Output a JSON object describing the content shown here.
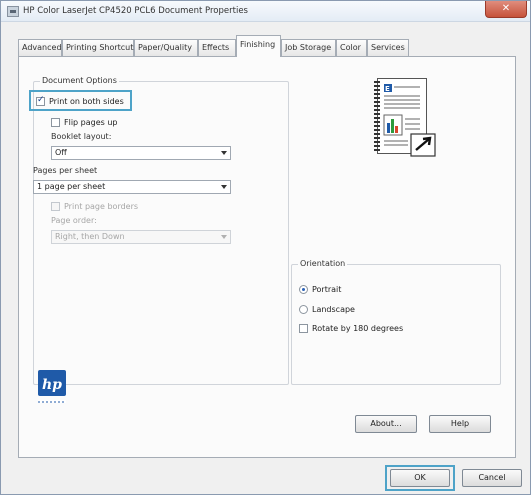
{
  "window": {
    "title": "HP Color LaserJet CP4520 PCL6 Document Properties",
    "close_label": "✕"
  },
  "tabs": [
    {
      "label": "Advanced",
      "active": false
    },
    {
      "label": "Printing Shortcuts",
      "active": false
    },
    {
      "label": "Paper/Quality",
      "active": false
    },
    {
      "label": "Effects",
      "active": false
    },
    {
      "label": "Finishing",
      "active": true
    },
    {
      "label": "Job Storage",
      "active": false
    },
    {
      "label": "Color",
      "active": false
    },
    {
      "label": "Services",
      "active": false
    }
  ],
  "document_options": {
    "group_label": "Document Options",
    "print_both_sides": {
      "label": "Print on both sides",
      "checked": true
    },
    "flip_pages_up": {
      "label": "Flip pages up",
      "checked": false
    },
    "booklet_layout_label": "Booklet layout:",
    "booklet_layout_value": "Off",
    "pages_per_sheet_label": "Pages per sheet",
    "pages_per_sheet_value": "1 page per sheet",
    "print_page_borders": {
      "label": "Print page borders",
      "checked": false,
      "disabled": true
    },
    "page_order_label": "Page order:",
    "page_order_value": "Right, then Down"
  },
  "orientation": {
    "group_label": "Orientation",
    "portrait": {
      "label": "Portrait",
      "selected": true
    },
    "landscape": {
      "label": "Landscape",
      "selected": false
    },
    "rotate": {
      "label": "Rotate by 180 degrees",
      "checked": false
    }
  },
  "buttons": {
    "about": "About...",
    "help": "Help",
    "ok": "OK",
    "cancel": "Cancel"
  },
  "colors": {
    "highlight": "#4ea3c8",
    "hp_blue": "#1f5aa8"
  },
  "icons": {
    "hp_logo": "hp-logo",
    "booklet_preview": "duplex-document-preview-icon"
  }
}
